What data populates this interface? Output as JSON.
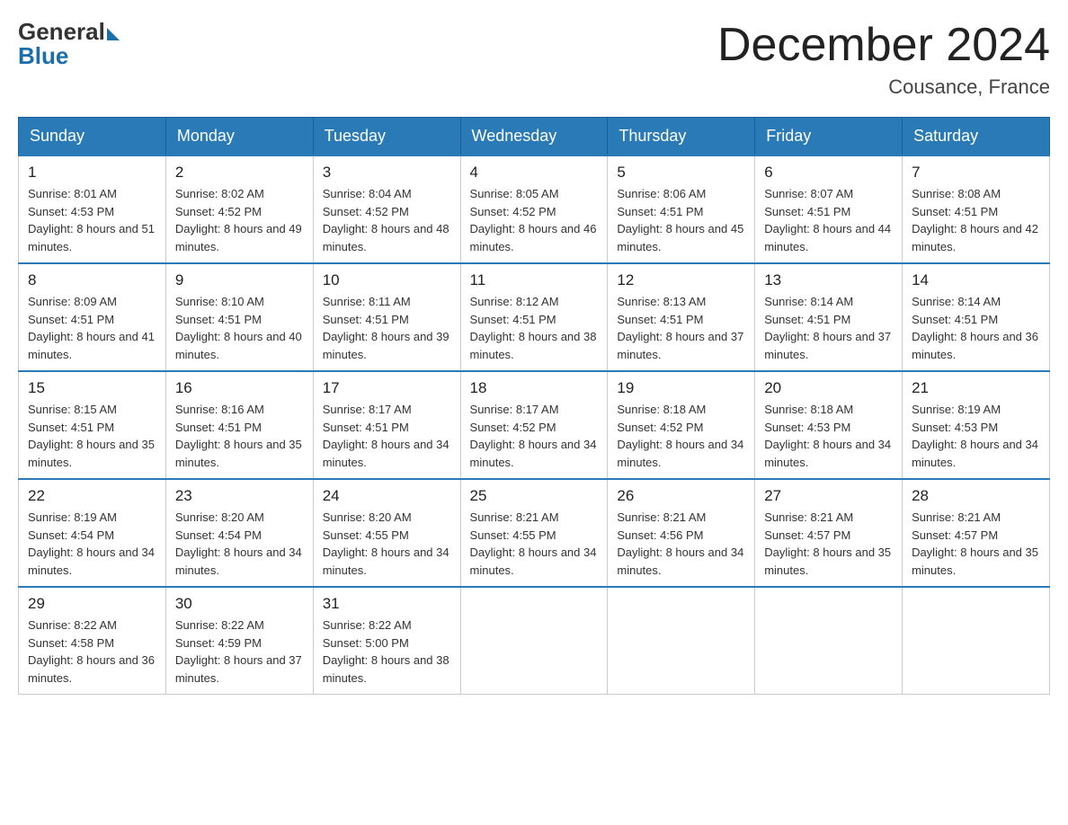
{
  "header": {
    "logo_general": "General",
    "logo_blue": "Blue",
    "month_title": "December 2024",
    "location": "Cousance, France"
  },
  "days_of_week": [
    "Sunday",
    "Monday",
    "Tuesday",
    "Wednesday",
    "Thursday",
    "Friday",
    "Saturday"
  ],
  "weeks": [
    [
      {
        "day": "1",
        "sunrise": "8:01 AM",
        "sunset": "4:53 PM",
        "daylight": "8 hours and 51 minutes."
      },
      {
        "day": "2",
        "sunrise": "8:02 AM",
        "sunset": "4:52 PM",
        "daylight": "8 hours and 49 minutes."
      },
      {
        "day": "3",
        "sunrise": "8:04 AM",
        "sunset": "4:52 PM",
        "daylight": "8 hours and 48 minutes."
      },
      {
        "day": "4",
        "sunrise": "8:05 AM",
        "sunset": "4:52 PM",
        "daylight": "8 hours and 46 minutes."
      },
      {
        "day": "5",
        "sunrise": "8:06 AM",
        "sunset": "4:51 PM",
        "daylight": "8 hours and 45 minutes."
      },
      {
        "day": "6",
        "sunrise": "8:07 AM",
        "sunset": "4:51 PM",
        "daylight": "8 hours and 44 minutes."
      },
      {
        "day": "7",
        "sunrise": "8:08 AM",
        "sunset": "4:51 PM",
        "daylight": "8 hours and 42 minutes."
      }
    ],
    [
      {
        "day": "8",
        "sunrise": "8:09 AM",
        "sunset": "4:51 PM",
        "daylight": "8 hours and 41 minutes."
      },
      {
        "day": "9",
        "sunrise": "8:10 AM",
        "sunset": "4:51 PM",
        "daylight": "8 hours and 40 minutes."
      },
      {
        "day": "10",
        "sunrise": "8:11 AM",
        "sunset": "4:51 PM",
        "daylight": "8 hours and 39 minutes."
      },
      {
        "day": "11",
        "sunrise": "8:12 AM",
        "sunset": "4:51 PM",
        "daylight": "8 hours and 38 minutes."
      },
      {
        "day": "12",
        "sunrise": "8:13 AM",
        "sunset": "4:51 PM",
        "daylight": "8 hours and 37 minutes."
      },
      {
        "day": "13",
        "sunrise": "8:14 AM",
        "sunset": "4:51 PM",
        "daylight": "8 hours and 37 minutes."
      },
      {
        "day": "14",
        "sunrise": "8:14 AM",
        "sunset": "4:51 PM",
        "daylight": "8 hours and 36 minutes."
      }
    ],
    [
      {
        "day": "15",
        "sunrise": "8:15 AM",
        "sunset": "4:51 PM",
        "daylight": "8 hours and 35 minutes."
      },
      {
        "day": "16",
        "sunrise": "8:16 AM",
        "sunset": "4:51 PM",
        "daylight": "8 hours and 35 minutes."
      },
      {
        "day": "17",
        "sunrise": "8:17 AM",
        "sunset": "4:51 PM",
        "daylight": "8 hours and 34 minutes."
      },
      {
        "day": "18",
        "sunrise": "8:17 AM",
        "sunset": "4:52 PM",
        "daylight": "8 hours and 34 minutes."
      },
      {
        "day": "19",
        "sunrise": "8:18 AM",
        "sunset": "4:52 PM",
        "daylight": "8 hours and 34 minutes."
      },
      {
        "day": "20",
        "sunrise": "8:18 AM",
        "sunset": "4:53 PM",
        "daylight": "8 hours and 34 minutes."
      },
      {
        "day": "21",
        "sunrise": "8:19 AM",
        "sunset": "4:53 PM",
        "daylight": "8 hours and 34 minutes."
      }
    ],
    [
      {
        "day": "22",
        "sunrise": "8:19 AM",
        "sunset": "4:54 PM",
        "daylight": "8 hours and 34 minutes."
      },
      {
        "day": "23",
        "sunrise": "8:20 AM",
        "sunset": "4:54 PM",
        "daylight": "8 hours and 34 minutes."
      },
      {
        "day": "24",
        "sunrise": "8:20 AM",
        "sunset": "4:55 PM",
        "daylight": "8 hours and 34 minutes."
      },
      {
        "day": "25",
        "sunrise": "8:21 AM",
        "sunset": "4:55 PM",
        "daylight": "8 hours and 34 minutes."
      },
      {
        "day": "26",
        "sunrise": "8:21 AM",
        "sunset": "4:56 PM",
        "daylight": "8 hours and 34 minutes."
      },
      {
        "day": "27",
        "sunrise": "8:21 AM",
        "sunset": "4:57 PM",
        "daylight": "8 hours and 35 minutes."
      },
      {
        "day": "28",
        "sunrise": "8:21 AM",
        "sunset": "4:57 PM",
        "daylight": "8 hours and 35 minutes."
      }
    ],
    [
      {
        "day": "29",
        "sunrise": "8:22 AM",
        "sunset": "4:58 PM",
        "daylight": "8 hours and 36 minutes."
      },
      {
        "day": "30",
        "sunrise": "8:22 AM",
        "sunset": "4:59 PM",
        "daylight": "8 hours and 37 minutes."
      },
      {
        "day": "31",
        "sunrise": "8:22 AM",
        "sunset": "5:00 PM",
        "daylight": "8 hours and 38 minutes."
      },
      null,
      null,
      null,
      null
    ]
  ]
}
